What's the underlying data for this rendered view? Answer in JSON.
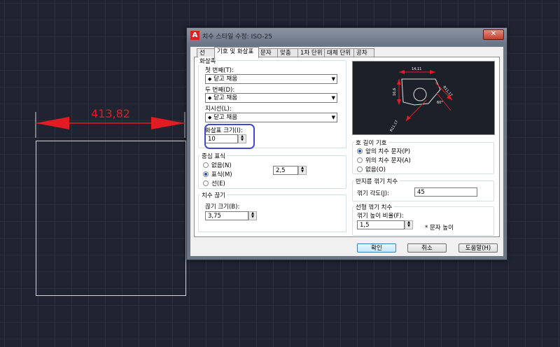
{
  "canvas": {
    "dimension_text": "413,82",
    "colors": {
      "dimension": "#e31c23",
      "background": "#1f2430",
      "geometry": "#d7d7d7"
    }
  },
  "dialog": {
    "title": "치수 스타일 수정: ISO-25",
    "app_icon": "autocad-a-icon",
    "close_label": "✕",
    "tabs": [
      {
        "label": "선",
        "active": false
      },
      {
        "label": "기호 및 화살표",
        "active": true
      },
      {
        "label": "문자",
        "active": false
      },
      {
        "label": "맞춤",
        "active": false
      },
      {
        "label": "1차 단위",
        "active": false
      },
      {
        "label": "대체 단위",
        "active": false
      },
      {
        "label": "공차",
        "active": false
      }
    ],
    "arrowheads": {
      "group_title": "화살촉",
      "first_label": "첫 번째(T):",
      "first_value": "닫고 채움",
      "second_label": "두 번째(D):",
      "second_value": "닫고 채움",
      "leader_label": "지시선(L):",
      "leader_value": "닫고 채움",
      "size_label": "화살표 크기(I):",
      "size_value": "10"
    },
    "center_marks": {
      "group_title": "중심 표식",
      "options": [
        "없음(N)",
        "표식(M)",
        "선(E)"
      ],
      "selected": "표식(M)",
      "size_value": "2,5"
    },
    "dim_break": {
      "group_title": "치수 끊기",
      "size_label": "끊기 크기(B):",
      "size_value": "3,75"
    },
    "arc_length_symbol": {
      "group_title": "호 길이 기호",
      "options": [
        "앞의 치수 문자(P)",
        "위의 치수 문자(A)",
        "없음(O)"
      ],
      "selected": "앞의 치수 문자(P)"
    },
    "radius_jog": {
      "group_title": "반지름 꺾기 치수",
      "angle_label": "꺾기 각도(J):",
      "angle_value": "45"
    },
    "linear_jog": {
      "group_title": "선형 꺾기 치수",
      "factor_label": "꺾기 높이 비율(F):",
      "factor_value": "1,5",
      "factor_suffix": "* 문자 높이"
    },
    "preview": {
      "dim_top": "14,11",
      "dim_left": "16,6",
      "dim_right": "R11,17",
      "dim_angle": "60°",
      "dim_bottom": "R11,17"
    },
    "buttons": {
      "ok": "확인",
      "cancel": "취소",
      "help": "도움말(H)"
    }
  }
}
